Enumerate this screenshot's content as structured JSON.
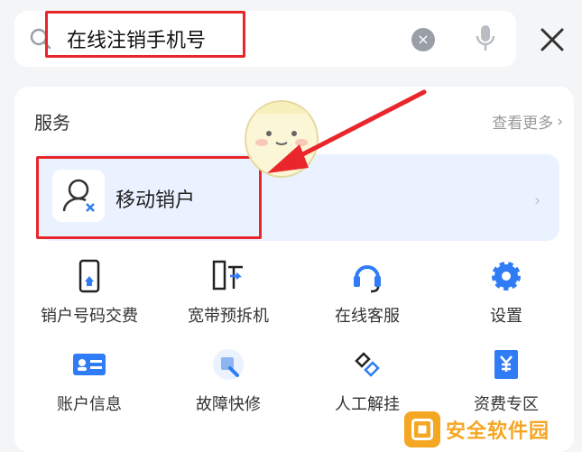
{
  "search": {
    "value": "在线注销手机号"
  },
  "header": {
    "clear_symbol": "×"
  },
  "services": {
    "title": "服务",
    "more_label": "查看更多",
    "featured": {
      "label": "移动销户"
    },
    "grid": [
      {
        "label": "销户号码交费",
        "icon": "phone-payment-icon"
      },
      {
        "label": "宽带预拆机",
        "icon": "broadband-icon"
      },
      {
        "label": "在线客服",
        "icon": "headset-icon"
      },
      {
        "label": "设置",
        "icon": "gear-icon"
      },
      {
        "label": "账户信息",
        "icon": "id-card-icon"
      },
      {
        "label": "故障快修",
        "icon": "repair-icon"
      },
      {
        "label": "人工解挂",
        "icon": "unlink-icon"
      },
      {
        "label": "资费专区",
        "icon": "yuan-receipt-icon"
      }
    ]
  },
  "watermark": {
    "text": "安全软件园"
  },
  "colors": {
    "accent_blue": "#2f7cf6",
    "highlight_red": "#e8262b",
    "banner_bg": "#eaf2ff"
  }
}
